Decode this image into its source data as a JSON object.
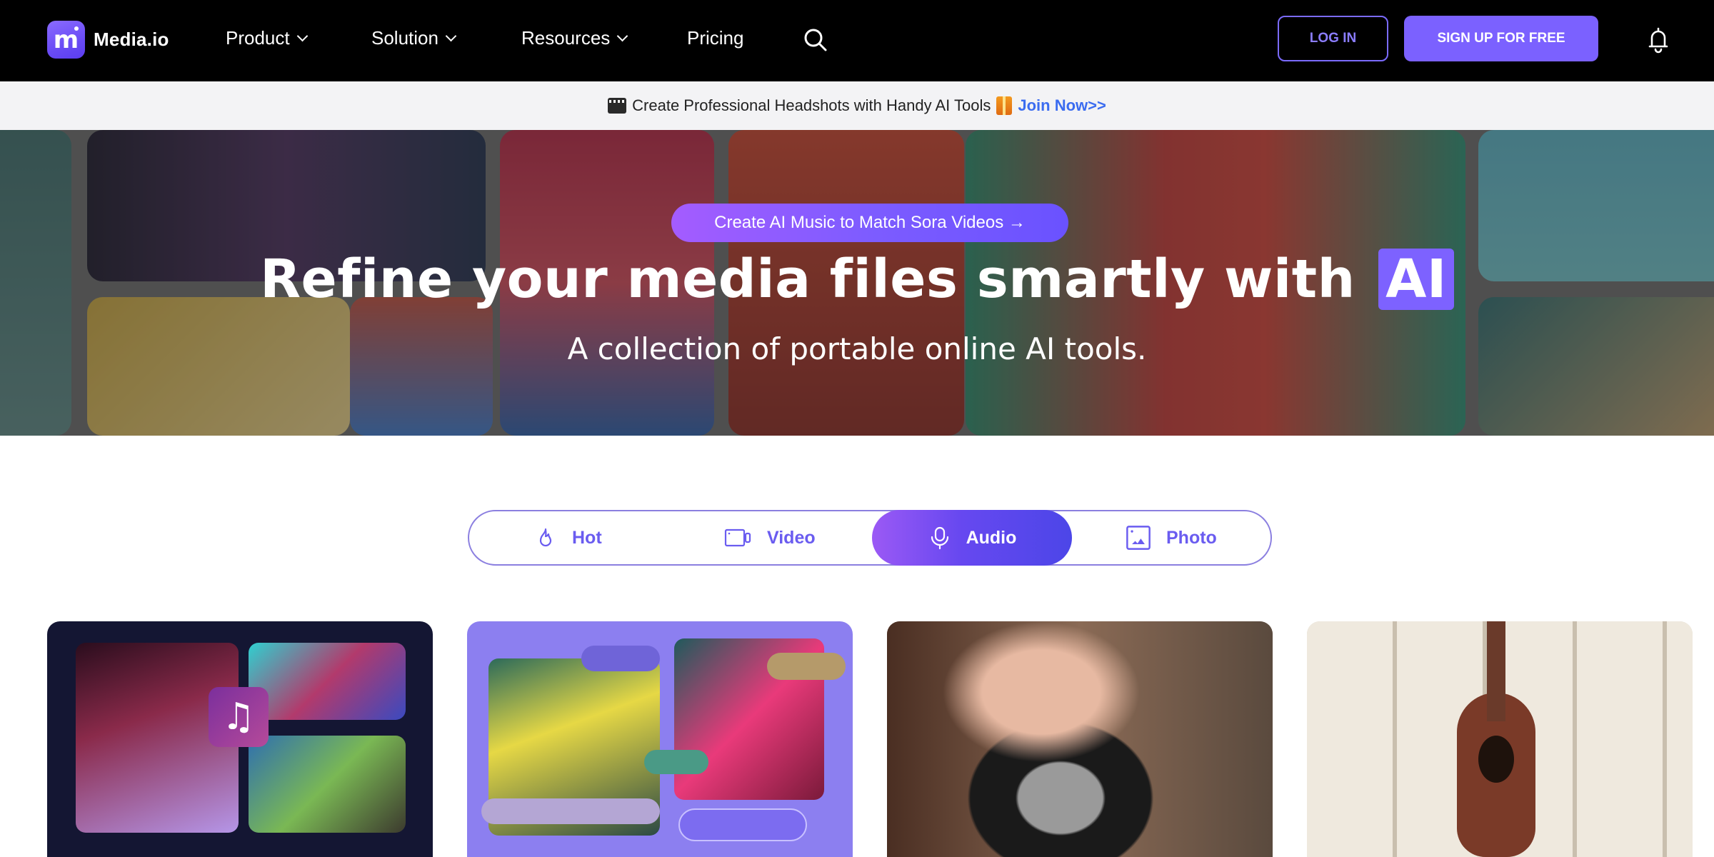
{
  "brand": {
    "name": "Media.io",
    "accent": "#7b61ff"
  },
  "nav": {
    "items": [
      {
        "label": "Product",
        "has_dropdown": true
      },
      {
        "label": "Solution",
        "has_dropdown": true
      },
      {
        "label": "Resources",
        "has_dropdown": true
      },
      {
        "label": "Pricing",
        "has_dropdown": false
      }
    ],
    "search_icon": "search-icon",
    "login_label": "LOG IN",
    "signup_label": "SIGN UP FOR FREE",
    "notification_icon": "bell-icon"
  },
  "announcement": {
    "text": "Create Professional Headshots with Handy AI Tools",
    "link_label": "Join Now>>",
    "lead_icon": "clapperboard-icon",
    "trail_icon": "gift-icon"
  },
  "hero": {
    "pill_label": "Create AI Music to Match Sora Videos →",
    "title": "Refine your media files smartly with",
    "title_highlight": "AI",
    "subtitle": "A collection of portable online AI tools."
  },
  "category_tabs": {
    "selected": "Audio",
    "items": [
      {
        "label": "Hot",
        "icon": "flame-icon"
      },
      {
        "label": "Video",
        "icon": "video-camera-icon"
      },
      {
        "label": "Audio",
        "icon": "microphone-icon"
      },
      {
        "label": "Photo",
        "icon": "image-icon"
      }
    ]
  },
  "cards": [
    {
      "name": "ai-music-video-card",
      "icon": "music-note-icon"
    },
    {
      "name": "ai-voice-cover-card"
    },
    {
      "name": "vocal-recording-card"
    },
    {
      "name": "ukulele-music-card"
    }
  ]
}
